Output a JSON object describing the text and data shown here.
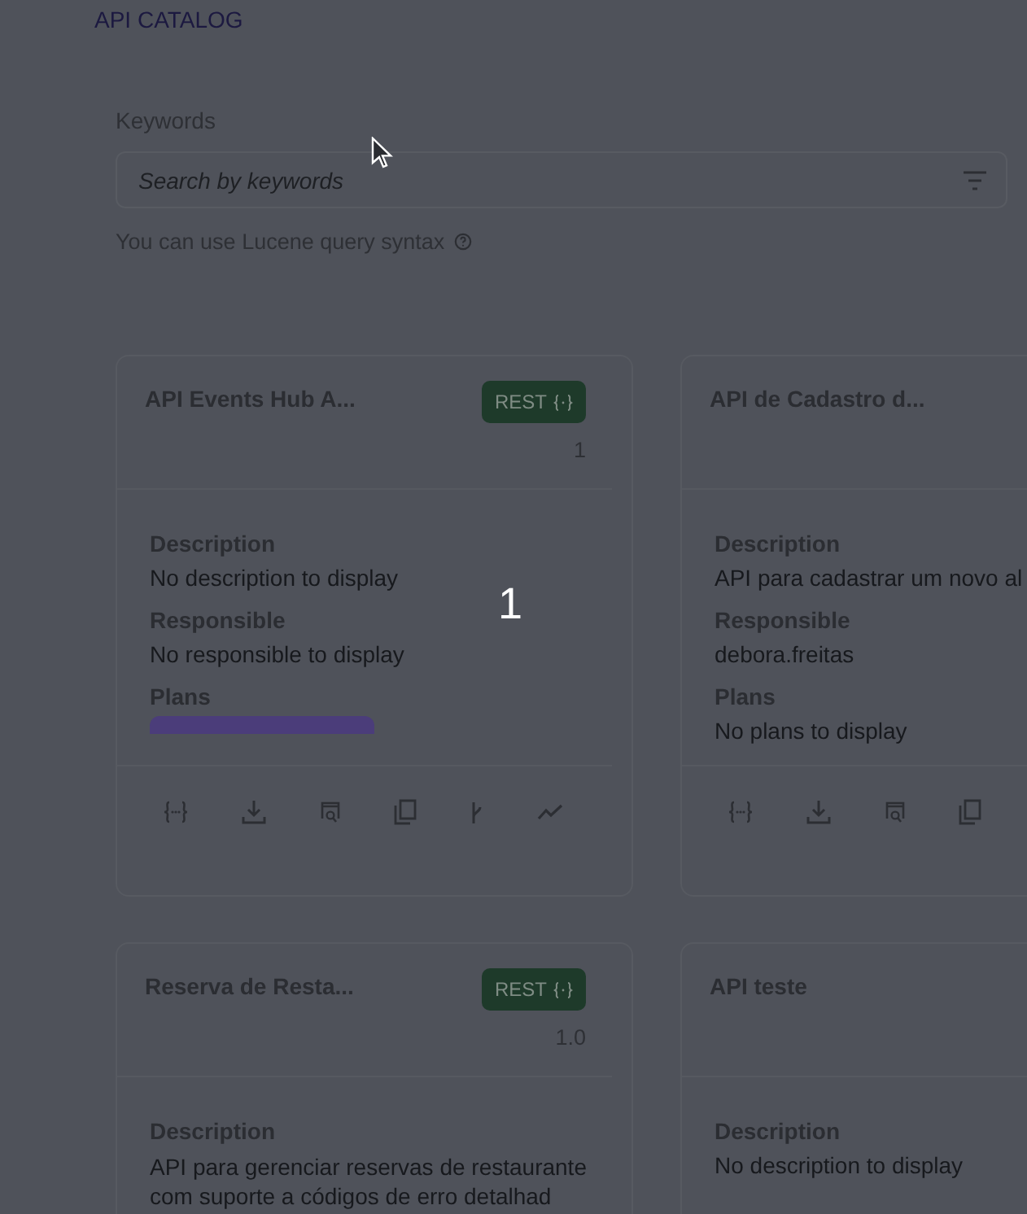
{
  "header": {
    "title": "API CATALOG"
  },
  "search": {
    "label": "Keywords",
    "placeholder": "Search by keywords",
    "hint": "You can use Lucene query syntax"
  },
  "step_marker": "1",
  "cards": [
    {
      "title": "API Events Hub A...",
      "type": "REST",
      "version": "1",
      "sections": [
        {
          "kind": "text",
          "label": "Description",
          "text": "No description to display"
        },
        {
          "kind": "text",
          "label": "Responsible",
          "text": "No responsible to display"
        },
        {
          "kind": "chip",
          "label": "Plans"
        }
      ],
      "actions": [
        {
          "kind": "braces"
        },
        {
          "kind": "download"
        },
        {
          "kind": "search-doc"
        },
        {
          "kind": "copy"
        },
        {
          "kind": "branch"
        },
        {
          "kind": "trend"
        }
      ]
    },
    {
      "title": "API de Cadastro d...",
      "sections": [
        {
          "kind": "text",
          "label": "Description",
          "text": "API para cadastrar um novo al"
        },
        {
          "kind": "text",
          "label": "Responsible",
          "text": "debora.freitas"
        },
        {
          "kind": "text",
          "label": "Plans",
          "text": "No plans to display"
        }
      ],
      "actions": [
        {
          "kind": "braces"
        },
        {
          "kind": "download"
        },
        {
          "kind": "search-doc"
        },
        {
          "kind": "copy"
        }
      ]
    },
    {
      "title": "Reserva de Resta...",
      "type": "REST",
      "version": "1.0",
      "sections": [
        {
          "kind": "text",
          "label": "Description",
          "text": "API para gerenciar reservas de restaurante com suporte a códigos de erro detalhad"
        }
      ]
    },
    {
      "title": "API teste",
      "sections": [
        {
          "kind": "text",
          "label": "Description",
          "text": "No description to display"
        }
      ]
    }
  ]
}
